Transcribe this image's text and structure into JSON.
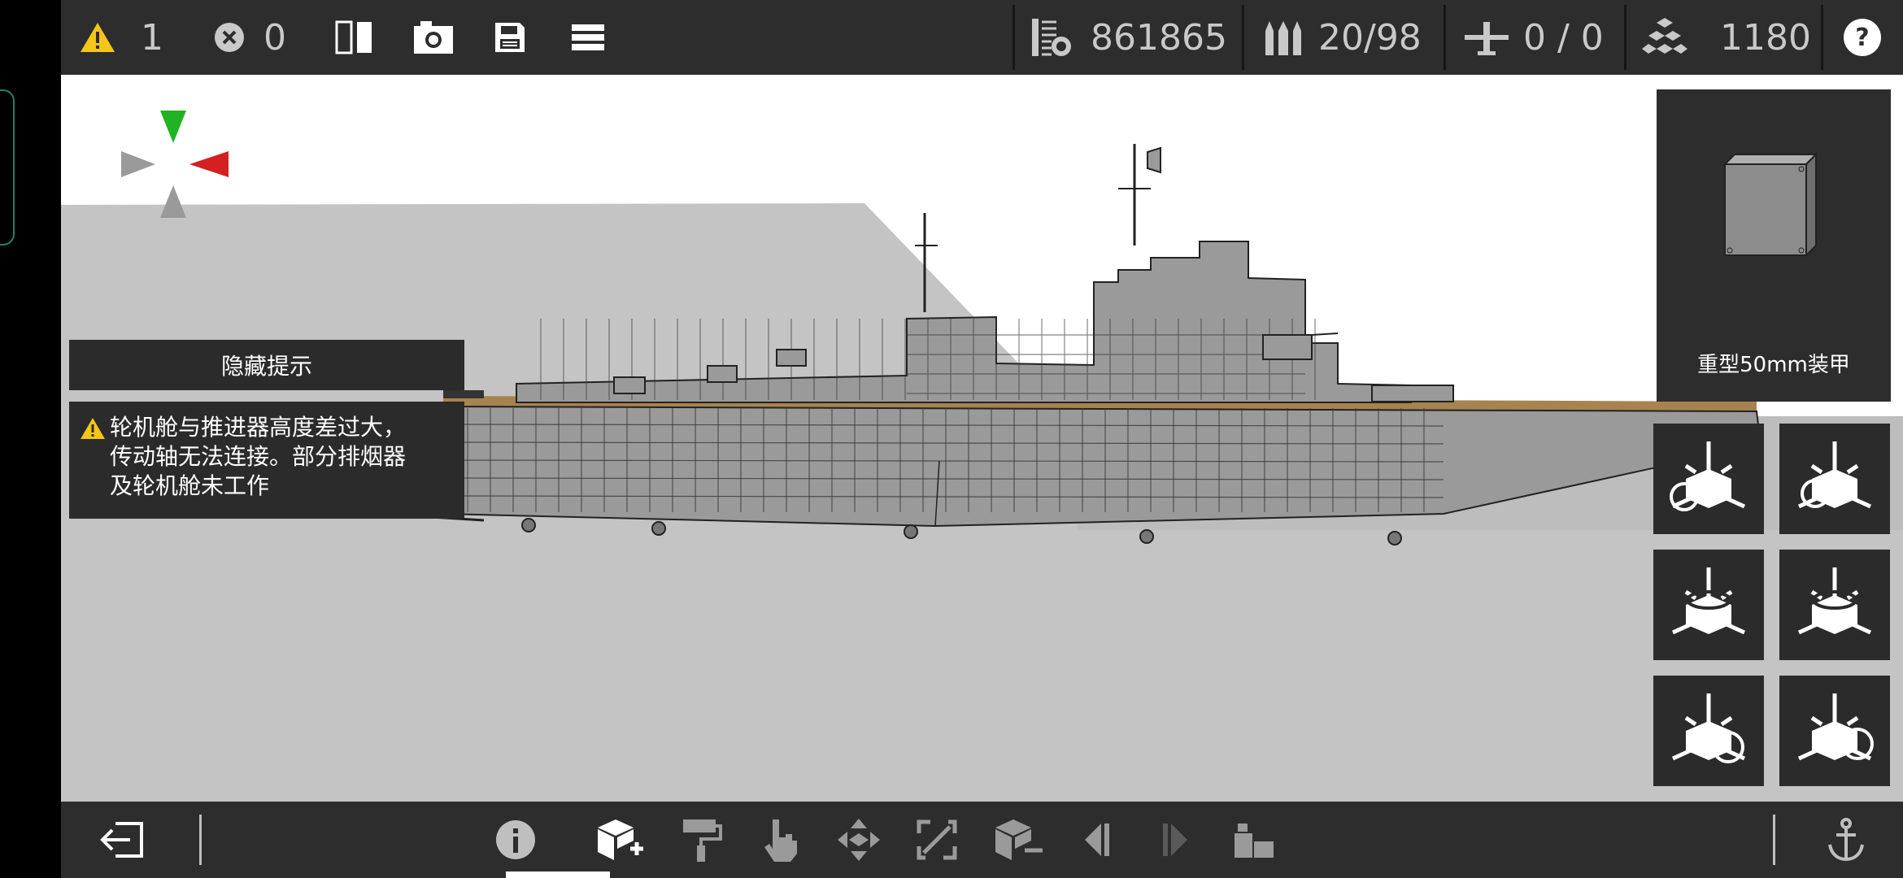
{
  "topbar": {
    "warning_count": "1",
    "error_count": "0",
    "money": "861865",
    "ammo": "20/98",
    "aircraft": "0 / 0",
    "parts": "1180"
  },
  "tips": {
    "hide_label": "隐藏提示",
    "warning_line1": "轮机舱与推进器高度差过大，",
    "warning_line2": "传动轴无法连接。部分排烟器",
    "warning_line3": "及轮机舱未工作"
  },
  "selected_part": {
    "name": "重型50mm装甲"
  },
  "colors": {
    "bar_bg": "#2d2d2d",
    "viewport_bg": "#c4c4c4",
    "warning_yellow": "#f5c518",
    "gizmo_green": "#21b321",
    "gizmo_red": "#d42020",
    "accent_teal": "#2c7d6a"
  },
  "icons": {
    "top": [
      "warning-icon",
      "error-icon",
      "mirror-icon",
      "screenshot-icon",
      "save-icon",
      "menu-icon",
      "money-icon",
      "ammo-icon",
      "aircraft-icon",
      "parts-icon",
      "help-icon"
    ],
    "bottom": [
      "exit-icon",
      "info-icon",
      "add-part-icon",
      "paint-icon",
      "select-icon",
      "move-icon",
      "scale-icon",
      "remove-part-icon",
      "undo-icon",
      "redo-icon",
      "assembly-icon",
      "anchor-icon"
    ]
  }
}
